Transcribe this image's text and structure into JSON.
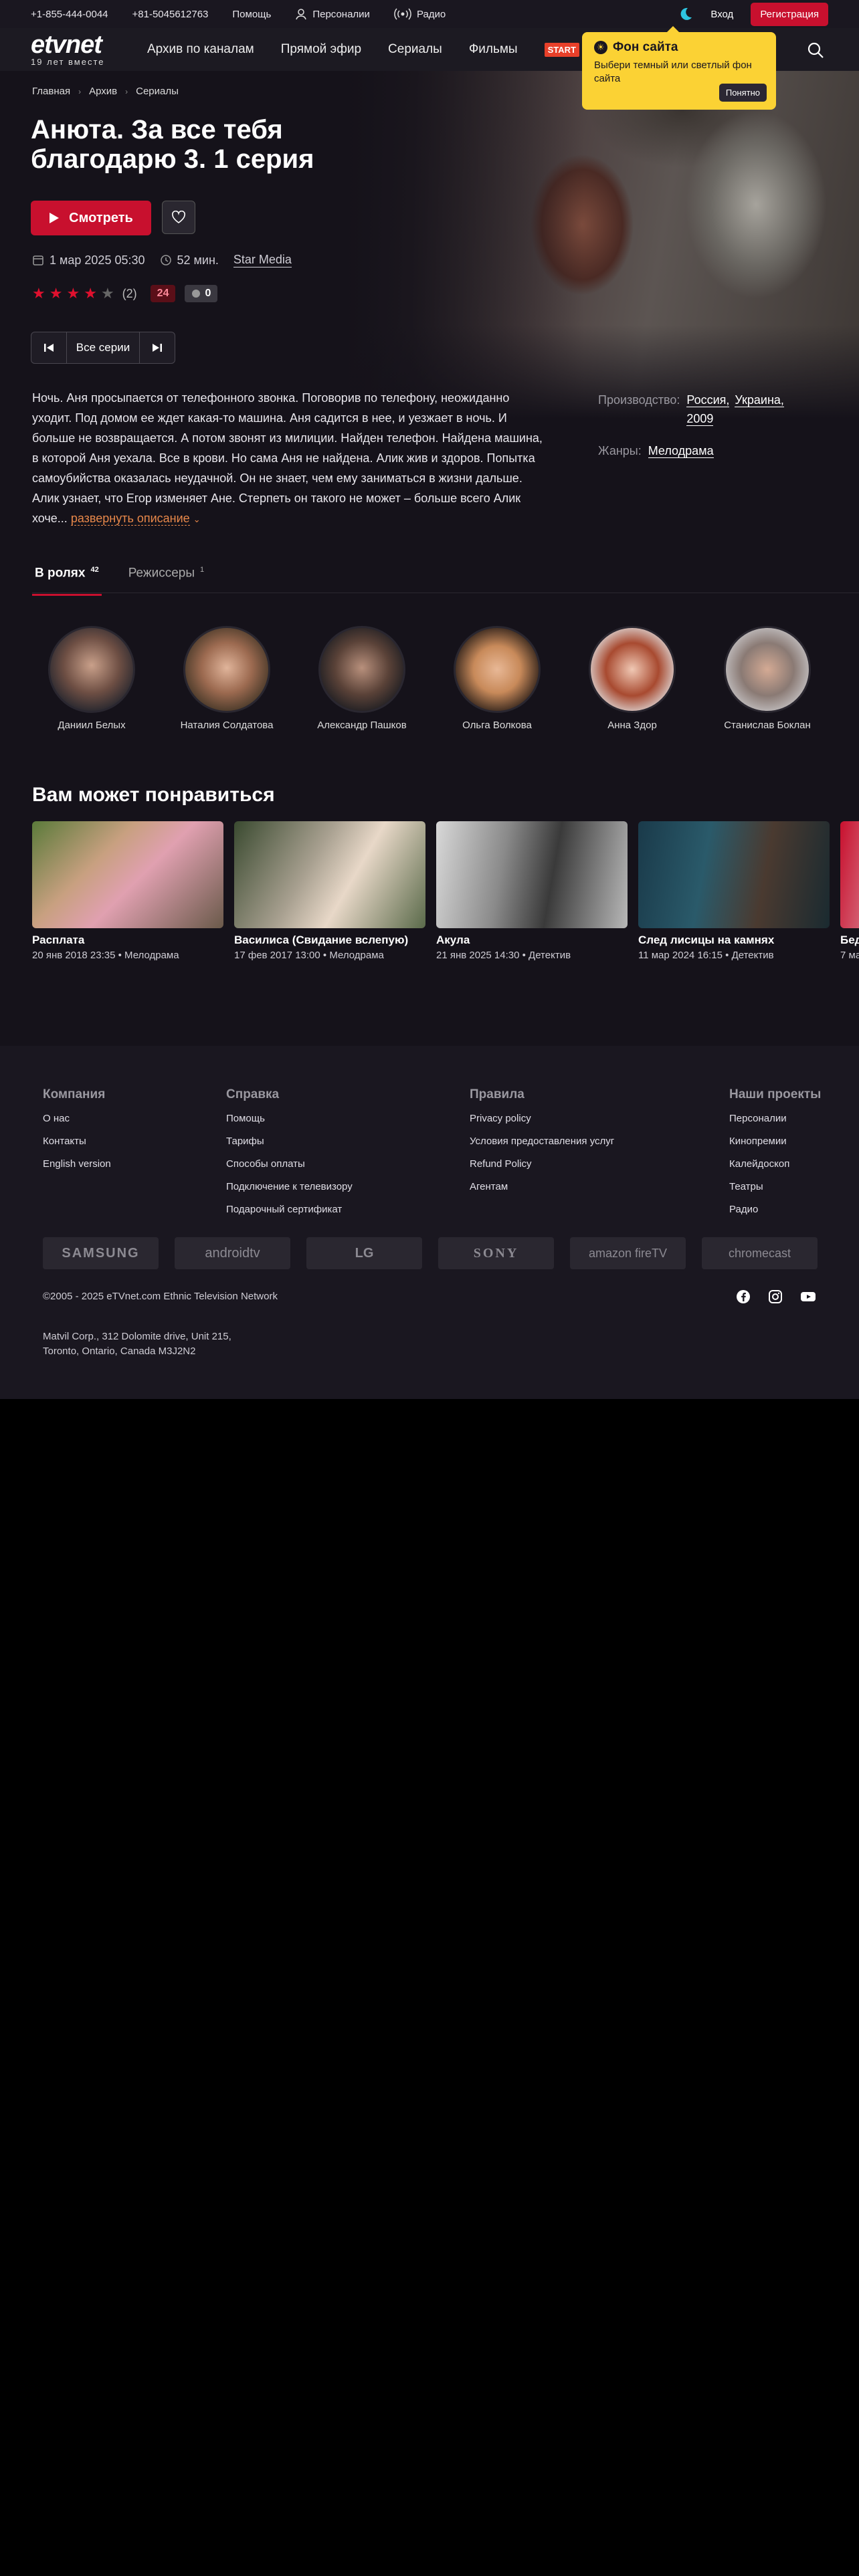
{
  "topbar": {
    "phone1": "+1-855-444-0044",
    "phone2": "+81-5045612763",
    "help": "Помощь",
    "personali": "Персоналии",
    "radio": "Радио",
    "login": "Вход",
    "register": "Регистрация"
  },
  "logo": {
    "name": "etvnet",
    "tagline": "19 лет вместе"
  },
  "nav": {
    "items": [
      "Архив по каналам",
      "Прямой эфир",
      "Сериалы",
      "Фильмы"
    ],
    "start": "START"
  },
  "tooltip": {
    "title": "Фон сайта",
    "body": "Выбери темный или светлый фон сайта",
    "button": "Понятно"
  },
  "breadcrumbs": [
    "Главная",
    "Архив",
    "Сериалы"
  ],
  "title": "Анюта. За все тебя благодарю 3. 1 серия",
  "watch_label": "Смотреть",
  "meta": {
    "date": "1 мар 2025 05:30",
    "duration": "52 мин.",
    "studio": "Star Media"
  },
  "rating": {
    "stars": 4,
    "max": 5,
    "votes": "(2)",
    "age_badge": "24",
    "comments": "0"
  },
  "episodes": {
    "all_label": "Все серии"
  },
  "description": {
    "text": "Ночь. Аня просыпается от телефонного звонка. Поговорив по телефону, неожиданно уходит. Под домом ее ждет какая-то машина. Аня садится в нее, и уезжает в ночь. И больше не возвращается. А потом звонят из милиции. Найден телефон. Найдена машина, в которой Аня уехала. Все в крови. Но сама Аня не найдена. Алик жив и здоров. Попытка самоубийства оказалась неудачной. Он не знает, чем ему заниматься в жизни дальше. Алик узнает, что Егор изменяет Ане. Стерпеть он такого не может – больше всего Алик хоче...",
    "more": "развернуть описание"
  },
  "info": {
    "production_label": "Производство:",
    "production": [
      "Россия,",
      "Украина,",
      "2009"
    ],
    "genre_label": "Жанры:",
    "genre": "Мелодрама"
  },
  "tabs": [
    {
      "label": "В ролях",
      "count": "42"
    },
    {
      "label": "Режиссеры",
      "count": "1"
    }
  ],
  "cast": [
    {
      "name": "Даниил Белых"
    },
    {
      "name": "Наталия Солдатова"
    },
    {
      "name": "Александр Пашков"
    },
    {
      "name": "Ольга Волкова"
    },
    {
      "name": "Анна Здор"
    },
    {
      "name": "Станислав Боклан"
    }
  ],
  "recommend_title": "Вам может понравиться",
  "cards": [
    {
      "name": "Расплата",
      "meta": "20 янв 2018 23:35 • Мелодрама"
    },
    {
      "name": "Василиса (Свидание вслепую)",
      "meta": "17 фев 2017 13:00 • Мелодрама"
    },
    {
      "name": "Акула",
      "meta": "21 янв 2025 14:30 • Детектив"
    },
    {
      "name": "След лисицы на камнях",
      "meta": "11 мар 2024 16:15 • Детектив"
    },
    {
      "name": "Бед",
      "meta": "7 ма"
    }
  ],
  "footer": {
    "company": {
      "title": "Компания",
      "links": [
        "О нас",
        "Контакты",
        "English version"
      ]
    },
    "help": {
      "title": "Справка",
      "links": [
        "Помощь",
        "Тарифы",
        "Способы оплаты",
        "Подключение к телевизору",
        "Подарочный сертификат"
      ]
    },
    "rules": {
      "title": "Правила",
      "links": [
        "Privacy policy",
        "Условия предоставления услуг",
        "Refund Policy",
        "Агентам"
      ]
    },
    "projects": {
      "title": "Наши проекты",
      "links": [
        "Персоналии",
        "Кинопремии",
        "Калейдоскоп",
        "Театры",
        "Радио"
      ]
    },
    "partners": [
      "SAMSUNG",
      "androidtv",
      "LG",
      "SONY",
      "amazon fireTV",
      "chromecast"
    ],
    "copyright": "©2005 - 2025 eTVnet.com Ethnic Television Network",
    "address1": "Matvil Corp., 312 Dolomite drive, Unit 215,",
    "address2": "Toronto, Ontario, Canada M3J2N2"
  }
}
